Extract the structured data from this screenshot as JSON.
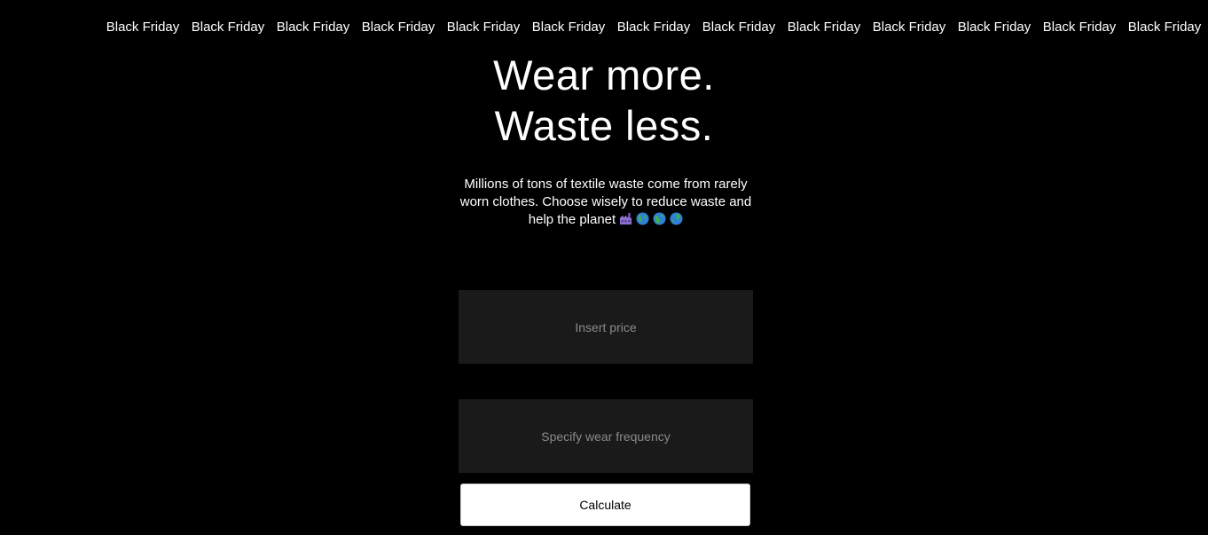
{
  "ticker": {
    "items": [
      "Black Friday",
      "Black Friday",
      "Black Friday",
      "Black Friday",
      "Black Friday",
      "Black Friday",
      "Black Friday",
      "Black Friday",
      "Black Friday",
      "Black Friday",
      "Black Friday",
      "Black Friday",
      "Black Friday"
    ]
  },
  "hero": {
    "headline_line1": "Wear more.",
    "headline_line2": "Waste less.",
    "subtitle": "Millions of tons of textile waste come from rarely worn clothes. Choose wisely to reduce waste and help the planet",
    "emojis": [
      "factory-icon",
      "globe-icon",
      "globe-icon",
      "globe-icon"
    ]
  },
  "form": {
    "price_placeholder": "Insert price",
    "frequency_placeholder": "Specify wear frequency",
    "calculate_label": "Calculate"
  },
  "colors": {
    "background": "#000000",
    "field_background": "#1a1a1a",
    "placeholder": "#8a8a8a",
    "button_background": "#ffffff"
  }
}
